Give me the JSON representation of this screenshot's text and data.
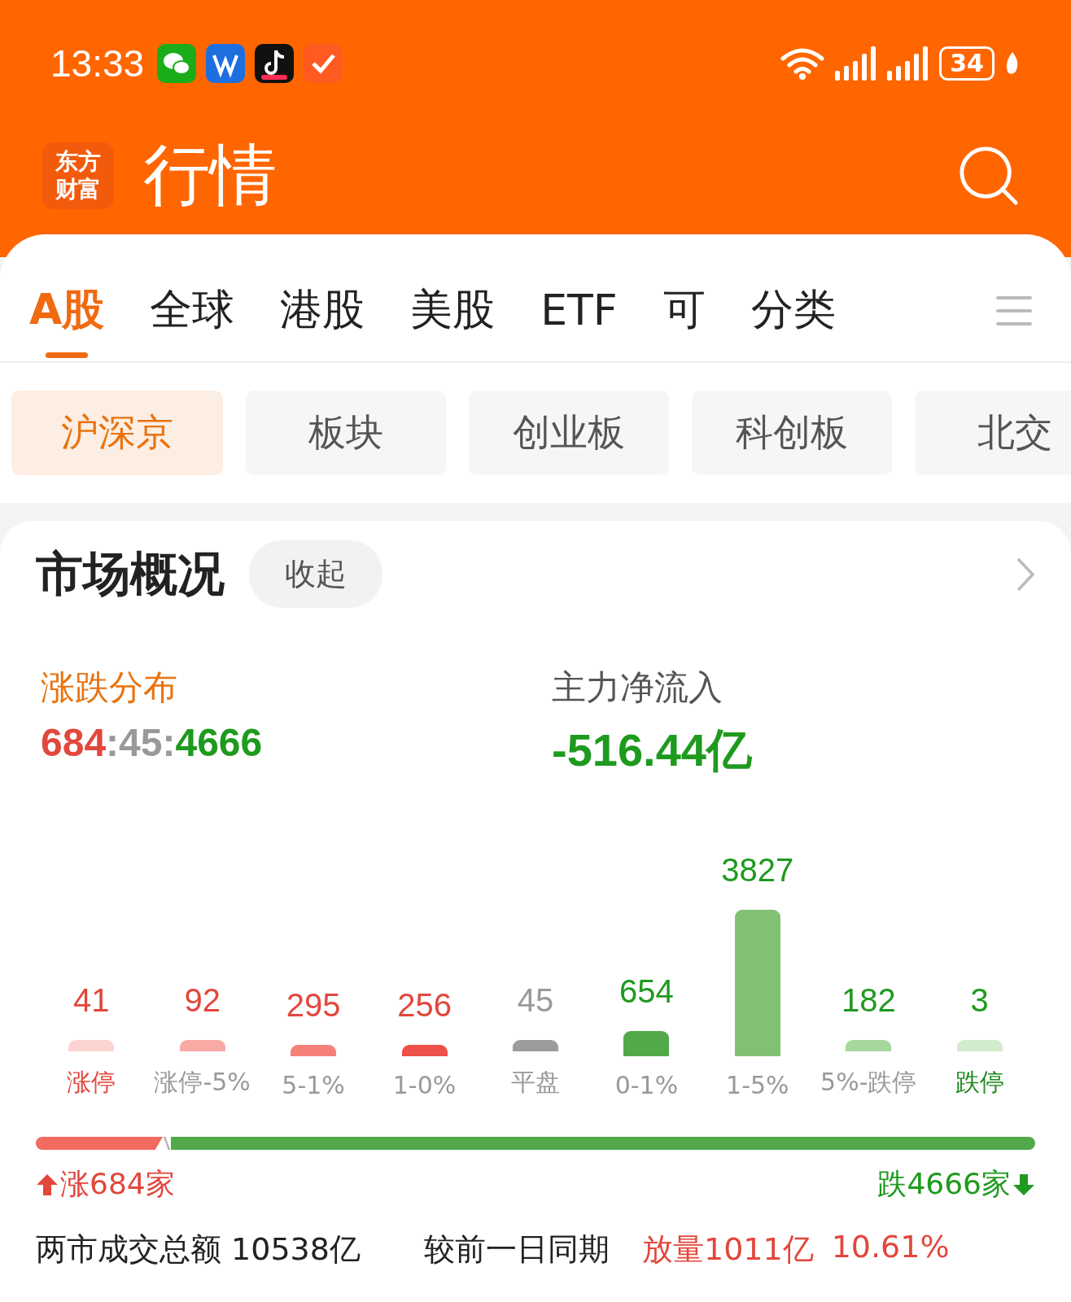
{
  "status_bar": {
    "time": "13:33",
    "battery": "34"
  },
  "header": {
    "logo_lines": [
      "东方",
      "财富"
    ],
    "title": "行情"
  },
  "tabs": [
    {
      "label": "A股",
      "selected": true
    },
    {
      "label": "全球",
      "selected": false
    },
    {
      "label": "港股",
      "selected": false
    },
    {
      "label": "美股",
      "selected": false
    },
    {
      "label": "ETF",
      "selected": false
    },
    {
      "label": "可",
      "selected": false
    },
    {
      "label": "分类",
      "selected": false
    }
  ],
  "chips": [
    {
      "label": "沪深京",
      "selected": true
    },
    {
      "label": "板块",
      "selected": false
    },
    {
      "label": "创业板",
      "selected": false
    },
    {
      "label": "科创板",
      "selected": false
    },
    {
      "label": "北交",
      "selected": false
    }
  ],
  "overview": {
    "title": "市场概况",
    "collapse_button": "收起",
    "distribution": {
      "label": "涨跌分布",
      "parts": [
        {
          "text": "684",
          "kind": "up"
        },
        {
          "text": ":",
          "kind": "flat"
        },
        {
          "text": "45",
          "kind": "flat"
        },
        {
          "text": ":",
          "kind": "flat"
        },
        {
          "text": "4666",
          "kind": "down"
        }
      ]
    },
    "net_inflow": {
      "label": "主力净流入",
      "value": "-516.44亿"
    },
    "bars": [
      {
        "count": "41",
        "label": "涨停",
        "kind": "up",
        "label_highlight": true,
        "color": "#fbd3d0"
      },
      {
        "count": "92",
        "label": "涨停-5%",
        "kind": "up",
        "label_highlight": false,
        "color": "#f9aaa5"
      },
      {
        "count": "295",
        "label": "5-1%",
        "kind": "up",
        "label_highlight": false,
        "color": "#f5807a"
      },
      {
        "count": "256",
        "label": "1-0%",
        "kind": "up",
        "label_highlight": false,
        "color": "#ee5149"
      },
      {
        "count": "45",
        "label": "平盘",
        "kind": "flat",
        "label_highlight": false,
        "color": "#9c9c9c"
      },
      {
        "count": "654",
        "label": "0-1%",
        "kind": "down",
        "label_highlight": false,
        "color": "#52a94a"
      },
      {
        "count": "3827",
        "label": "1-5%",
        "kind": "down",
        "label_highlight": false,
        "color": "#82c174"
      },
      {
        "count": "182",
        "label": "5%-跌停",
        "kind": "down",
        "label_highlight": false,
        "color": "#a8d79e"
      },
      {
        "count": "3",
        "label": "跌停",
        "kind": "down",
        "label_highlight": true,
        "color": "#d3ebcd"
      }
    ],
    "breadth_bar": [
      {
        "kind": "up",
        "level": 0.127
      },
      {
        "kind": "flat",
        "level": 0.008
      },
      {
        "kind": "down"
      }
    ],
    "up_count": "涨684家",
    "down_count": "跌4666家",
    "turnover": {
      "label": "两市成交总额 10538亿",
      "compare": "较前一日同期",
      "change": "放量1011亿",
      "percent": "10.61%"
    }
  }
}
